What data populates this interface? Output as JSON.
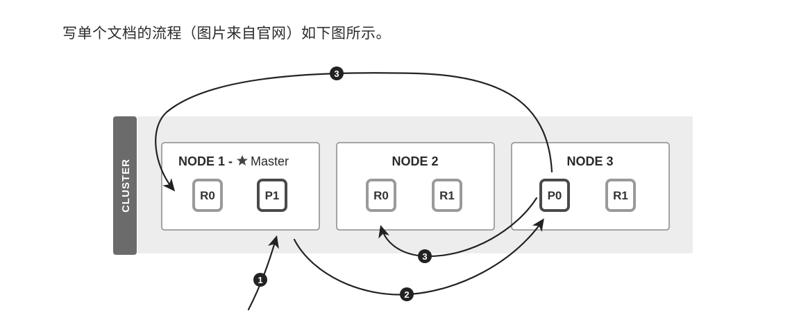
{
  "caption": "写单个文档的流程（图片来自官网）如下图所示。",
  "cluster": {
    "label": "CLUSTER"
  },
  "nodes": [
    {
      "title": "NODE 1 -",
      "master_suffix": "Master",
      "master_icon": "star-icon",
      "shards": [
        {
          "label": "R0",
          "kind": "replica"
        },
        {
          "label": "P1",
          "kind": "primary"
        }
      ]
    },
    {
      "title": "NODE 2",
      "shards": [
        {
          "label": "R0",
          "kind": "replica"
        },
        {
          "label": "R1",
          "kind": "replica"
        }
      ]
    },
    {
      "title": "NODE 3",
      "shards": [
        {
          "label": "P0",
          "kind": "primary"
        },
        {
          "label": "R1",
          "kind": "replica"
        }
      ]
    }
  ],
  "steps": [
    {
      "label": "1"
    },
    {
      "label": "2"
    },
    {
      "label": "3"
    },
    {
      "label": "3"
    }
  ],
  "colors": {
    "cluster_bar": "#6b6b6b",
    "band": "#ececec",
    "node_border": "#8a8a8a",
    "replica_border": "#9a9a9a",
    "primary_border": "#4a4a4a",
    "arrow": "#222222",
    "step_circle": "#222222"
  }
}
